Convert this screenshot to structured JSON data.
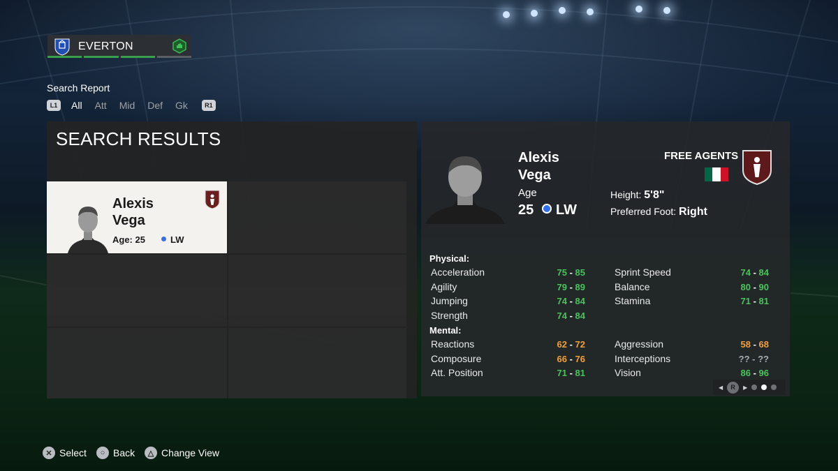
{
  "club": {
    "name": "EVERTON",
    "crest_icon": "everton-crest-icon",
    "status_icon": "hand-up-icon",
    "accent": "#3a9e4c"
  },
  "search_report": {
    "title": "Search Report",
    "left_button": "L1",
    "right_button": "R1",
    "tabs": [
      "All",
      "Att",
      "Mid",
      "Def",
      "Gk"
    ],
    "active_tab": "All"
  },
  "results": {
    "title": "SEARCH RESULTS",
    "cards": [
      {
        "first_name": "Alexis",
        "last_name": "Vega",
        "age_label": "Age: 25",
        "position": "LW"
      }
    ]
  },
  "player": {
    "first_name": "Alexis",
    "last_name": "Vega",
    "age_label": "Age",
    "age": "25",
    "position": "LW",
    "status": "FREE AGENTS",
    "nation_flag": [
      "#006847",
      "#ffffff",
      "#ce1126"
    ],
    "height_label": "Height:",
    "height": "5'8\"",
    "foot_label": "Preferred Foot:",
    "foot": "Right",
    "physical_label": "Physical:",
    "mental_label": "Mental:",
    "physical_left": [
      {
        "name": "Acceleration",
        "lo": "75",
        "hi": "85",
        "color": "green"
      },
      {
        "name": "Agility",
        "lo": "79",
        "hi": "89",
        "color": "green"
      },
      {
        "name": "Jumping",
        "lo": "74",
        "hi": "84",
        "color": "green"
      },
      {
        "name": "Strength",
        "lo": "74",
        "hi": "84",
        "color": "green"
      }
    ],
    "physical_right": [
      {
        "name": "Sprint Speed",
        "lo": "74",
        "hi": "84",
        "color": "green"
      },
      {
        "name": "Balance",
        "lo": "80",
        "hi": "90",
        "color": "green"
      },
      {
        "name": "Stamina",
        "lo": "71",
        "hi": "81",
        "color": "green"
      }
    ],
    "mental_left": [
      {
        "name": "Reactions",
        "lo": "62",
        "hi": "72",
        "color": "orange"
      },
      {
        "name": "Composure",
        "lo": "66",
        "hi": "76",
        "color": "orange"
      },
      {
        "name": "Att. Position",
        "lo": "71",
        "hi": "81",
        "color": "green"
      }
    ],
    "mental_right": [
      {
        "name": "Aggression",
        "lo": "58",
        "hi": "68",
        "color": "orange"
      },
      {
        "name": "Interceptions",
        "lo": "??",
        "hi": "??",
        "color": "unknown"
      },
      {
        "name": "Vision",
        "lo": "86",
        "hi": "96",
        "color": "green"
      }
    ],
    "pager_button": "R"
  },
  "footer": [
    {
      "icon": "cross-button-icon",
      "glyph": "✕",
      "label": "Select"
    },
    {
      "icon": "circle-button-icon",
      "glyph": "○",
      "label": "Back"
    },
    {
      "icon": "triangle-button-icon",
      "glyph": "△",
      "label": "Change View"
    }
  ]
}
